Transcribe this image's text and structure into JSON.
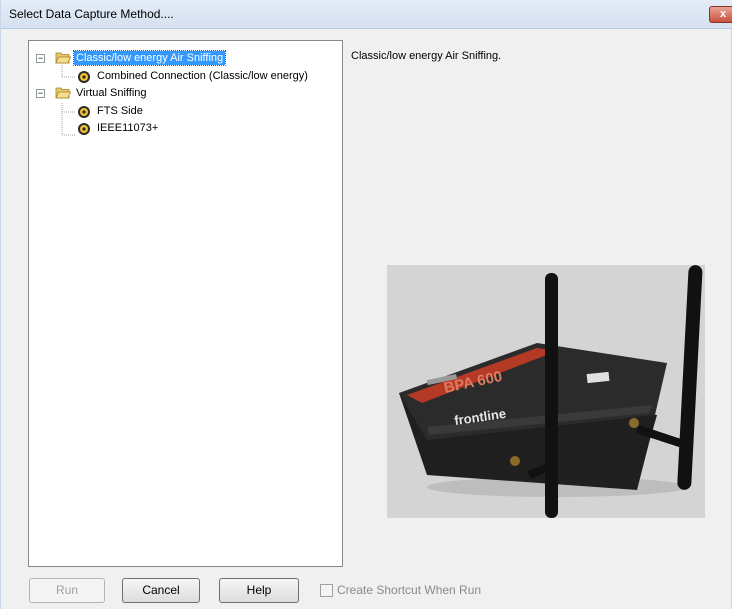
{
  "window": {
    "title": "Select Data Capture Method....",
    "close_label": "x"
  },
  "tree": {
    "items": [
      {
        "label": "Classic/low energy Air Sniffing",
        "type": "folder",
        "expanded": true,
        "selected": true
      },
      {
        "label": "Combined Connection (Classic/low energy)",
        "type": "item"
      },
      {
        "label": "Virtual Sniffing",
        "type": "folder",
        "expanded": true
      },
      {
        "label": "FTS Side",
        "type": "item"
      },
      {
        "label": "IEEE11073+",
        "type": "item"
      }
    ],
    "toggle_symbol": "−"
  },
  "description": {
    "text": "Classic/low energy Air Sniffing."
  },
  "device": {
    "model": "BPA 600",
    "brand": "frontline"
  },
  "buttons": {
    "run": "Run",
    "cancel": "Cancel",
    "help": "Help"
  },
  "shortcut": {
    "label": "Create Shortcut When Run",
    "checked": false
  },
  "colors": {
    "selection": "#3399ff",
    "close_button": "#c75038",
    "device_accent": "#b43a26"
  }
}
